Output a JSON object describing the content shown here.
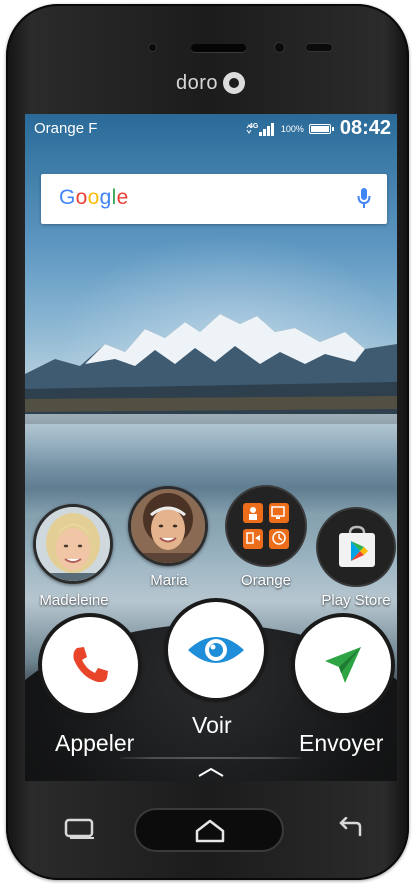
{
  "device": {
    "brand": "doro"
  },
  "status_bar": {
    "carrier": "Orange F",
    "network": "4G",
    "battery_percent": "100%",
    "time": "08:42"
  },
  "search_widget": {
    "logo_text": "Google",
    "mic_icon": "microphone-icon"
  },
  "contacts": [
    {
      "name": "Madeleine"
    },
    {
      "name": "Maria"
    }
  ],
  "apps": [
    {
      "name": "Orange",
      "icon": "orange-folder-icon"
    },
    {
      "name": "Play Store",
      "icon": "play-store-icon"
    }
  ],
  "dock": {
    "call_label": "Appeler",
    "view_label": "Voir",
    "send_label": "Envoyer"
  },
  "colors": {
    "call_red": "#e8452b",
    "view_blue": "#1f8ed8",
    "send_green": "#2ea444",
    "orange_brand": "#ec6d1a"
  }
}
